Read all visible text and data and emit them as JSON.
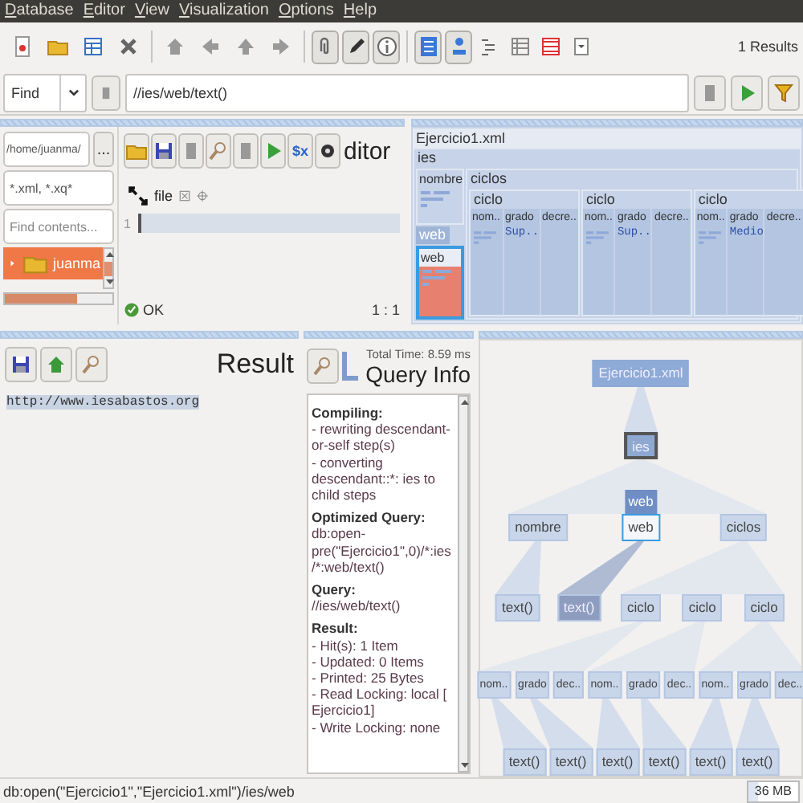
{
  "menu": [
    {
      "label": "Database"
    },
    {
      "label": "Editor"
    },
    {
      "label": "View"
    },
    {
      "label": "Visualization"
    },
    {
      "label": "Options"
    },
    {
      "label": "Help"
    }
  ],
  "toolbar": {
    "toggles": [
      {
        "on": true
      },
      {
        "on": true
      },
      {
        "on": true
      },
      {
        "on": true
      },
      {
        "on": true
      },
      {
        "on": false
      },
      {
        "on": false
      },
      {
        "on": false
      },
      {
        "on": false
      }
    ],
    "results": "1 Results"
  },
  "find": {
    "mode": "Find",
    "query": "//ies/web/text()"
  },
  "file_browser": {
    "path": "/home/juanma/",
    "browse": "...",
    "filter": "*.xml, *.xq*",
    "search_placeholder": "Find contents...",
    "items": [
      {
        "label": "juanma",
        "selected": true
      }
    ]
  },
  "editor": {
    "title": "ditor",
    "var_button": "$x",
    "tabs": [
      {
        "label": "file",
        "selected": true
      }
    ],
    "lines": [
      "1"
    ],
    "status": "OK",
    "position": "1 : 1"
  },
  "map": {
    "title": "Ejercicio1.xml",
    "root": {
      "label": "ies",
      "children": [
        {
          "label": "nombre",
          "selected": false
        },
        {
          "label": "web",
          "selected": true,
          "hover_label": "web"
        },
        {
          "label": "ciclos",
          "selected": false,
          "children": [
            {
              "label": "ciclo",
              "children": [
                {
                  "label": "nom.."
                },
                {
                  "label": "grado",
                  "value": "Sup.."
                },
                {
                  "label": "decre.."
                }
              ]
            },
            {
              "label": "ciclo",
              "children": [
                {
                  "label": "nom.."
                },
                {
                  "label": "grado",
                  "value": "Sup.."
                },
                {
                  "label": "decre.."
                }
              ]
            },
            {
              "label": "ciclo",
              "children": [
                {
                  "label": "nom.."
                },
                {
                  "label": "grado",
                  "value": "Medio"
                },
                {
                  "label": "decre.."
                }
              ]
            }
          ]
        }
      ]
    }
  },
  "result": {
    "title": "Result",
    "text": "http://www.iesabastos.org"
  },
  "query_info": {
    "total_time": "Total Time: 8.59 ms",
    "title": "Query Info",
    "sections": [
      {
        "heading": "Compiling:",
        "lines": [
          "- rewriting descendant-or-self step(s)",
          "- converting descendant::*: ies to child steps"
        ]
      },
      {
        "heading": "Optimized Query:",
        "lines": [
          "db:open-pre(\"Ejercicio1\",0)/*:ies/*:web/text()"
        ]
      },
      {
        "heading": "Query:",
        "lines": [
          "//ies/web/text()"
        ]
      },
      {
        "heading": "Result:",
        "lines": [
          "- Hit(s): 1 Item",
          "- Updated: 0 Items",
          "- Printed: 25 Bytes",
          "- Read Locking: local [ Ejercicio1]",
          "- Write Locking: none"
        ]
      }
    ]
  },
  "tree": {
    "root": {
      "label": "Ejercicio1.xml",
      "kind": "document",
      "children": [
        {
          "label": "ies",
          "focused": true,
          "children": [
            {
              "label": "nombre",
              "children": [
                {
                  "label": "text()"
                }
              ]
            },
            {
              "label": "web",
              "selected": true,
              "hover_label": "web",
              "children": [
                {
                  "label": "text()",
                  "highlighted": true
                }
              ]
            },
            {
              "label": "ciclos",
              "children": [
                {
                  "label": "ciclo",
                  "children": [
                    {
                      "label": "nom..",
                      "children": [
                        {
                          "label": "text()"
                        }
                      ]
                    },
                    {
                      "label": "grado",
                      "children": [
                        {
                          "label": "text()"
                        }
                      ]
                    },
                    {
                      "label": "dec.."
                    }
                  ]
                },
                {
                  "label": "ciclo",
                  "children": [
                    {
                      "label": "nom..",
                      "children": [
                        {
                          "label": "text()"
                        }
                      ]
                    },
                    {
                      "label": "grado",
                      "children": [
                        {
                          "label": "text()"
                        }
                      ]
                    },
                    {
                      "label": "dec.."
                    }
                  ]
                },
                {
                  "label": "ciclo",
                  "children": [
                    {
                      "label": "nom..",
                      "children": [
                        {
                          "label": "text()"
                        }
                      ]
                    },
                    {
                      "label": "grado",
                      "children": [
                        {
                          "label": "text()"
                        }
                      ]
                    },
                    {
                      "label": "dec.."
                    }
                  ]
                }
              ]
            }
          ]
        }
      ]
    }
  },
  "status_bar": {
    "text": "db:open(\"Ejercicio1\",\"Ejercicio1.xml\")/ies/web",
    "memory": "36 MB"
  }
}
